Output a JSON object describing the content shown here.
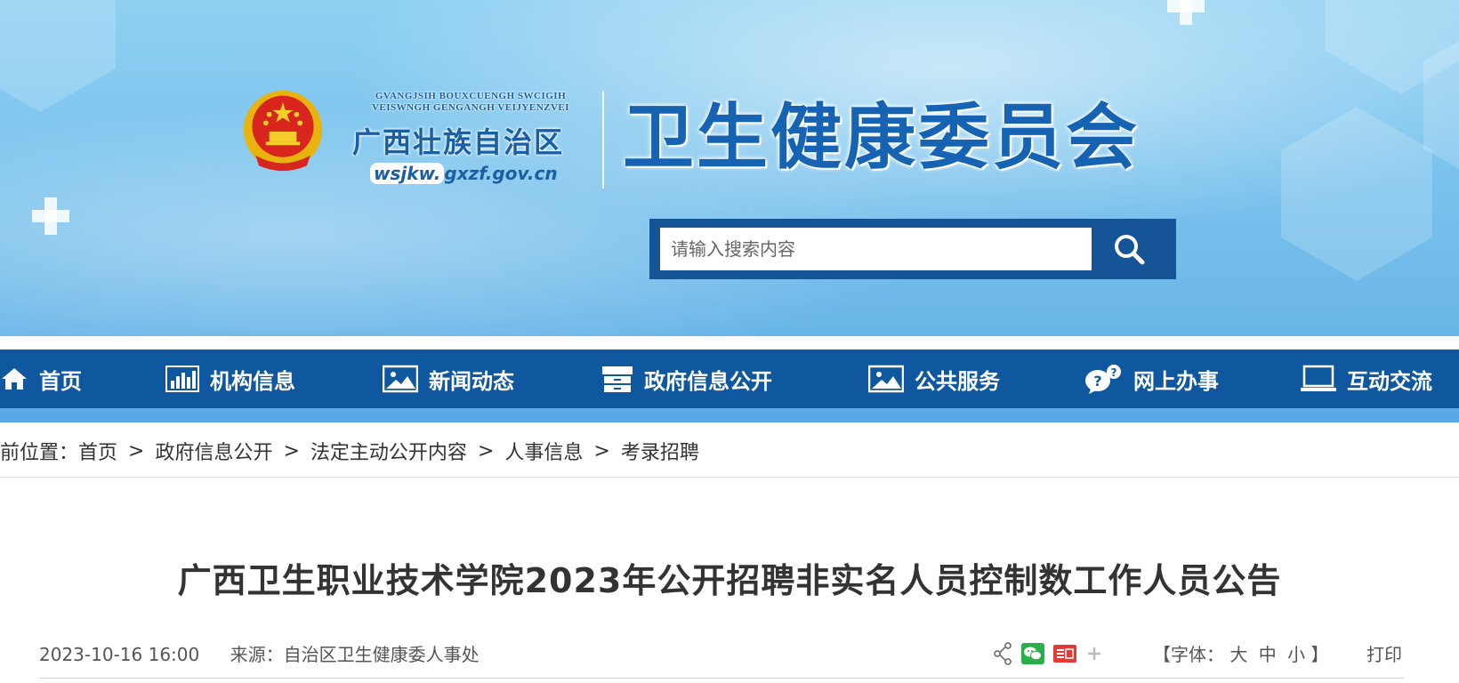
{
  "header": {
    "gov_pinyin_line1": "GVANGJSIH BOUXCUENGH SWCIGIH",
    "gov_pinyin_line2": "VEISWNGH GENGANGH VEIJYENZVEI",
    "gov_name": "广西壮族自治区",
    "url_prefix": "wsjkw.",
    "url_domain": "gxzf.gov.cn",
    "site_title": "卫生健康委员会"
  },
  "search": {
    "placeholder": "请输入搜索内容"
  },
  "nav": {
    "items": [
      {
        "label": "首页",
        "icon": "home-icon"
      },
      {
        "label": "机构信息",
        "icon": "bar-chart-icon"
      },
      {
        "label": "新闻动态",
        "icon": "image-icon"
      },
      {
        "label": "政府信息公开",
        "icon": "cabinet-icon"
      },
      {
        "label": "公共服务",
        "icon": "image-icon"
      },
      {
        "label": "网上办事",
        "icon": "question-chat-icon"
      },
      {
        "label": "互动交流",
        "icon": "monitor-icon"
      }
    ]
  },
  "breadcrumb": {
    "prefix": "前位置：",
    "items": [
      "首页",
      "政府信息公开",
      "法定主动公开内容",
      "人事信息",
      "考录招聘"
    ],
    "separator": ">"
  },
  "article": {
    "title": "广西卫生职业技术学院2023年公开招聘非实名人员控制数工作人员公告",
    "date": "2023-10-16 16:00",
    "source": "来源：自治区卫生健康委人事处"
  },
  "tools": {
    "font_size_open": "【字体：",
    "font_large": "大",
    "font_medium": "中",
    "font_small": "小",
    "font_size_close": "】",
    "print_label": "打印",
    "share_icons": [
      "share-icon",
      "wechat-icon",
      "toutiao-icon",
      "plus-icon"
    ]
  },
  "colors": {
    "nav_bg": "#0f58a0",
    "title_blue": "#1763b3",
    "search_border": "#155496"
  }
}
